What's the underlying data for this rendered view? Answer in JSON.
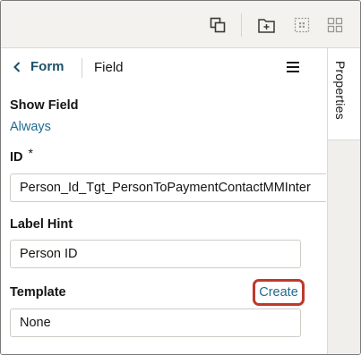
{
  "toolbar": {
    "icons": [
      "duplicate-icon",
      "add-folder-icon",
      "select-region-icon",
      "grid-layout-icon"
    ]
  },
  "side_panel": {
    "tab_label": "Properties"
  },
  "breadcrumb": {
    "back_label": "Form",
    "current": "Field"
  },
  "properties": {
    "show_field": {
      "label": "Show Field",
      "value": "Always"
    },
    "id": {
      "label": "ID",
      "required_mark": "*",
      "value": "Person_Id_Tgt_PersonToPaymentContactMMInter"
    },
    "label_hint": {
      "label": "Label Hint",
      "value": "Person ID"
    },
    "template": {
      "label": "Template",
      "action": "Create",
      "value": "None"
    }
  },
  "colors": {
    "link": "#1f6b8e",
    "highlight": "#c0392b",
    "toolbar_bg": "#f4f2ef"
  }
}
